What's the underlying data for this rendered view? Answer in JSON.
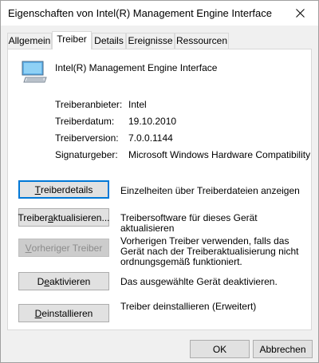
{
  "window": {
    "title": "Eigenschaften von Intel(R) Management Engine Interface"
  },
  "tabs": [
    {
      "label": "Allgemein",
      "active": false
    },
    {
      "label": "Treiber",
      "active": true
    },
    {
      "label": "Details",
      "active": false
    },
    {
      "label": "Ereignisse",
      "active": false
    },
    {
      "label": "Ressourcen",
      "active": false
    }
  ],
  "device": {
    "name": "Intel(R) Management Engine Interface",
    "icon": "computer-monitor-icon"
  },
  "driver_info": [
    {
      "label": "Treiberanbieter:",
      "value": "Intel"
    },
    {
      "label": "Treiberdatum:",
      "value": "19.10.2010"
    },
    {
      "label": "Treiberversion:",
      "value": "7.0.0.1144"
    },
    {
      "label": "Signaturgeber:",
      "value": "Microsoft Windows Hardware Compatibility"
    }
  ],
  "actions": [
    {
      "label_pre": "",
      "label_ul": "T",
      "label_post": "reiberdetails",
      "description": "Einzelheiten über Treiberdateien anzeigen",
      "enabled": true
    },
    {
      "label_pre": "Treiber ",
      "label_ul": "a",
      "label_post": "ktualisieren...",
      "description": "Treibersoftware für dieses Gerät aktualisieren",
      "enabled": true
    },
    {
      "label_pre": "",
      "label_ul": "V",
      "label_post": "orheriger Treiber",
      "description": "Vorherigen Treiber verwenden, falls das Gerät nach der Treiberaktualisierung nicht ordnungsgemäß funktioniert.",
      "enabled": false
    },
    {
      "label_pre": "D",
      "label_ul": "e",
      "label_post": "aktivieren",
      "description": "Das ausgewählte Gerät deaktivieren.",
      "enabled": true
    },
    {
      "label_pre": "",
      "label_ul": "D",
      "label_post": "einstallieren",
      "description": "Treiber deinstallieren (Erweitert)",
      "enabled": true
    }
  ],
  "footer": {
    "ok_label": "OK",
    "cancel_label": "Abbrechen"
  },
  "colors": {
    "focus_accent": "#0078d7",
    "dialog_bg": "#f0f0f0"
  }
}
